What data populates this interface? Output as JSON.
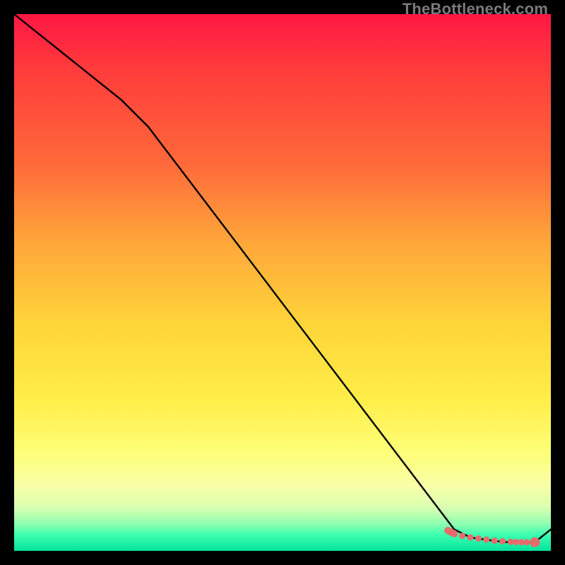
{
  "watermark": "TheBottleneck.com",
  "chart_data": {
    "type": "line",
    "title": "",
    "xlabel": "",
    "ylabel": "",
    "ylim": [
      0,
      100
    ],
    "xlim": [
      0,
      100
    ],
    "x": [
      0,
      10,
      20,
      25,
      82,
      85,
      90,
      92,
      94,
      97,
      100
    ],
    "values": [
      100,
      92,
      84,
      79,
      4,
      2.5,
      1.8,
      1.6,
      1.6,
      1.6,
      4
    ],
    "markers": {
      "comment": "red dotted band near curve minimum",
      "dots_x": [
        82,
        83.5,
        85,
        86.5,
        88,
        89.5,
        91,
        92.5,
        93.5,
        94.5,
        95.5,
        97
      ],
      "dots_val": [
        3.2,
        2.8,
        2.5,
        2.3,
        2.1,
        1.9,
        1.8,
        1.7,
        1.65,
        1.6,
        1.6,
        1.6
      ],
      "end_dot": {
        "x": 97,
        "val": 1.6
      },
      "color": "#e86b6b"
    },
    "line_color": "#000000",
    "line_width": 2.4
  }
}
